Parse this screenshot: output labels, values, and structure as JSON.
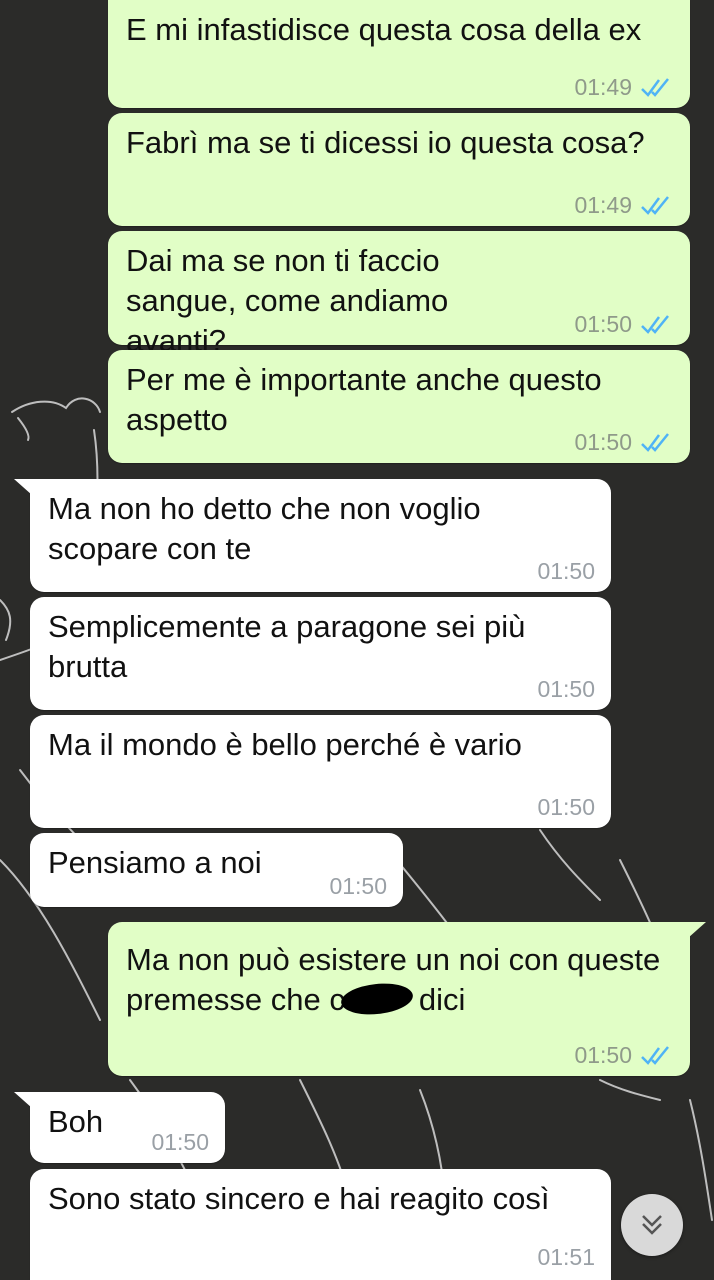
{
  "messages": [
    {
      "direction": "out",
      "text": "E mi infastidisce questa cosa della ex",
      "time": "01:49",
      "status": "read"
    },
    {
      "direction": "out",
      "text": "Fabrì ma se ti dicessi io questa cosa?",
      "time": "01:49",
      "status": "read"
    },
    {
      "direction": "out",
      "text": "Dai ma se non ti faccio sangue, come andiamo avanti?",
      "time": "01:50",
      "status": "read"
    },
    {
      "direction": "out",
      "text": "Per me è importante anche questo aspetto",
      "time": "01:50",
      "status": "read"
    },
    {
      "direction": "in",
      "text": "Ma non ho detto che non voglio scopare con te",
      "time": "01:50"
    },
    {
      "direction": "in",
      "text": "Semplicemente a paragone sei più brutta",
      "time": "01:50"
    },
    {
      "direction": "in",
      "text": "Ma il mondo è bello perché è vario",
      "time": "01:50"
    },
    {
      "direction": "in",
      "text": "Pensiamo a noi",
      "time": "01:50"
    },
    {
      "direction": "out",
      "text_before": "Ma non può esistere un noi con queste premesse che c",
      "text_after": "dici",
      "redacted": true,
      "time": "01:50",
      "status": "read"
    },
    {
      "direction": "in",
      "text": "Boh",
      "time": "01:50"
    },
    {
      "direction": "in",
      "text": "Sono stato sincero e hai reagito così",
      "time": "01:51"
    }
  ],
  "icons": {
    "read_receipt": "double-check-icon",
    "scroll_down": "chevron-double-down-icon"
  },
  "colors": {
    "outgoing_bubble": "#e1fec6",
    "incoming_bubble": "#ffffff",
    "wallpaper": "#2b2b29",
    "read_ticks": "#4fb3f6",
    "timestamp": "#8f9a8a"
  }
}
